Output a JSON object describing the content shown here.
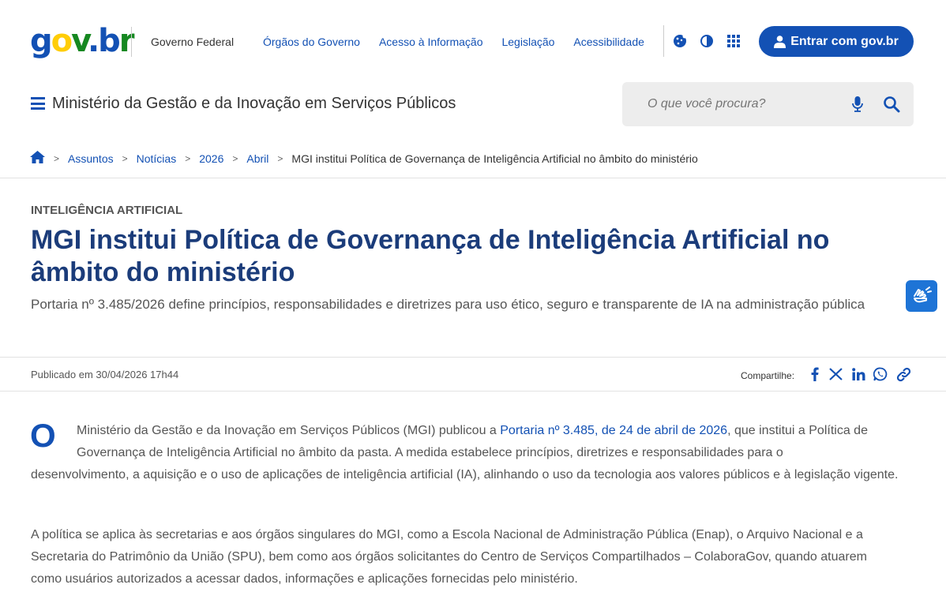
{
  "header": {
    "logo": {
      "g": "g",
      "o": "o",
      "v": "v",
      "dot": ".",
      "b": "b",
      "r": "r"
    },
    "gov_federal": "Governo Federal",
    "links": [
      "Órgãos do Governo",
      "Acesso à Informação",
      "Legislação",
      "Acessibilidade"
    ],
    "tools": [
      "cookie-icon",
      "contrast-icon",
      "apps-grid-icon"
    ],
    "login_label": "Entrar com gov.br"
  },
  "site": {
    "name": "Ministério da Gestão e da Inovação em Serviços Públicos",
    "search_placeholder": "O que você procura?"
  },
  "breadcrumb": {
    "items": [
      "Assuntos",
      "Notícias",
      "2026",
      "Abril"
    ],
    "current": "MGI institui Política de Governança de Inteligência Artificial no âmbito do ministério"
  },
  "article": {
    "category": "INTELIGÊNCIA ARTIFICIAL",
    "title": "MGI institui Política de Governança de Inteligência Artificial no âmbito do ministério",
    "subtitle": "Portaria nº 3.485/2026 define princípios, responsabilidades e diretrizes para uso ético, seguro e transparente de IA na administração pública",
    "published": "Publicado em 30/04/2026 17h44",
    "share_label": "Compartilhe:",
    "dropcap": "O",
    "p1_before": "Ministério da Gestão e da Inovação em Serviços Públicos (MGI) publicou a ",
    "p1_link": "Portaria nº 3.485, de 24 de abril de 2026",
    "p1_after1": ", que institui a Política de Governança de Inteligência Artificial no âmbito da pasta. A medida estabelece princípios, diretrizes e responsabilidades para o",
    "p1_after2": "desenvolvimento, a aquisição e o uso de aplicações de inteligência artificial (IA), alinhando o uso da tecnologia aos valores públicos e à legislação vigente.",
    "p2": "A política se aplica às secretarias e aos órgãos singulares do MGI, como a Escola Nacional de Administração Pública (Enap), o Arquivo Nacional e a Secretaria do Patrimônio da União (SPU), bem como aos órgãos solicitantes do Centro de Serviços Compartilhados – ColaboraGov, quando atuarem como usuários autorizados a acessar dados, informações e aplicações fornecidas pelo ministério."
  },
  "colors": {
    "primary": "#1351B4",
    "title": "#1B3C7A",
    "vlibras": "#1E74D6"
  }
}
